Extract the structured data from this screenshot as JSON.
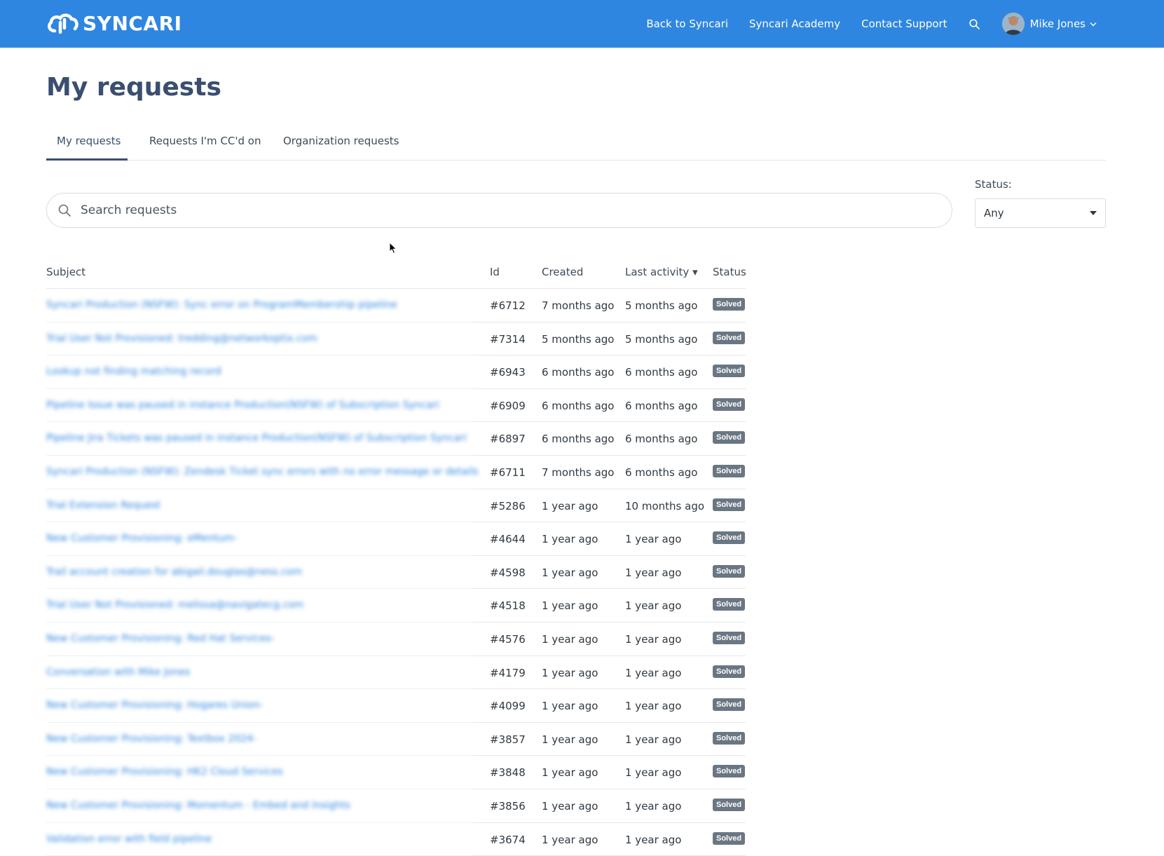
{
  "header": {
    "brand": "SYNCARI",
    "nav": [
      {
        "label": "Back to Syncari"
      },
      {
        "label": "Syncari Academy"
      },
      {
        "label": "Contact Support"
      }
    ],
    "user_name": "Mike Jones"
  },
  "page": {
    "title": "My requests"
  },
  "tabs": [
    {
      "label": "My requests"
    },
    {
      "label": "Requests I'm CC'd on"
    },
    {
      "label": "Organization requests"
    }
  ],
  "search": {
    "placeholder": "Search requests"
  },
  "filter": {
    "label": "Status:",
    "value": "Any"
  },
  "table": {
    "headers": {
      "subject": "Subject",
      "id": "Id",
      "created": "Created",
      "last_activity": "Last activity ▾",
      "status": "Status"
    },
    "rows": [
      {
        "subject": "Syncari Production (NSFW): Sync error on ProgramMembership pipeline",
        "id": "#6712",
        "created": "7 months ago",
        "last": "5 months ago",
        "status": "Solved"
      },
      {
        "subject": "Trial User Not Provisioned: tredding@networkoptix.com",
        "id": "#7314",
        "created": "5 months ago",
        "last": "5 months ago",
        "status": "Solved"
      },
      {
        "subject": "Lookup not finding matching record",
        "id": "#6943",
        "created": "6 months ago",
        "last": "6 months ago",
        "status": "Solved"
      },
      {
        "subject": "Pipeline Issue was paused in instance Production(NSFW) of Subscription Syncari",
        "id": "#6909",
        "created": "6 months ago",
        "last": "6 months ago",
        "status": "Solved"
      },
      {
        "subject": "Pipeline Jira Tickets was paused in instance Production(NSFW) of Subscription Syncari",
        "id": "#6897",
        "created": "6 months ago",
        "last": "6 months ago",
        "status": "Solved"
      },
      {
        "subject": "Syncari Production (NSFW): Zendesk Ticket sync errors with no error message or details",
        "id": "#6711",
        "created": "7 months ago",
        "last": "6 months ago",
        "status": "Solved"
      },
      {
        "subject": "Trial Extension Request",
        "id": "#5286",
        "created": "1 year ago",
        "last": "10 months ago",
        "status": "Solved"
      },
      {
        "subject": "New Customer Provisioning: eMentum-",
        "id": "#4644",
        "created": "1 year ago",
        "last": "1 year ago",
        "status": "Solved"
      },
      {
        "subject": "Trail account creation for abigail.douglas@ness.com",
        "id": "#4598",
        "created": "1 year ago",
        "last": "1 year ago",
        "status": "Solved"
      },
      {
        "subject": "Trial User Not Provisioned: melissa@navigatecg.com",
        "id": "#4518",
        "created": "1 year ago",
        "last": "1 year ago",
        "status": "Solved"
      },
      {
        "subject": "New Customer Provisioning: Red Hat Services-",
        "id": "#4576",
        "created": "1 year ago",
        "last": "1 year ago",
        "status": "Solved"
      },
      {
        "subject": "Conversation with Mike Jones",
        "id": "#4179",
        "created": "1 year ago",
        "last": "1 year ago",
        "status": "Solved"
      },
      {
        "subject": "New Customer Provisioning: Hogares Union-",
        "id": "#4099",
        "created": "1 year ago",
        "last": "1 year ago",
        "status": "Solved"
      },
      {
        "subject": "New Customer Provisioning: Textbox 2024-",
        "id": "#3857",
        "created": "1 year ago",
        "last": "1 year ago",
        "status": "Solved"
      },
      {
        "subject": "New Customer Provisioning: HK2 Cloud Services",
        "id": "#3848",
        "created": "1 year ago",
        "last": "1 year ago",
        "status": "Solved"
      },
      {
        "subject": "New Customer Provisioning: Momentum - Embed and Insights",
        "id": "#3856",
        "created": "1 year ago",
        "last": "1 year ago",
        "status": "Solved"
      },
      {
        "subject": "Validation error with field pipeline",
        "id": "#3674",
        "created": "1 year ago",
        "last": "1 year ago",
        "status": "Solved"
      }
    ]
  }
}
